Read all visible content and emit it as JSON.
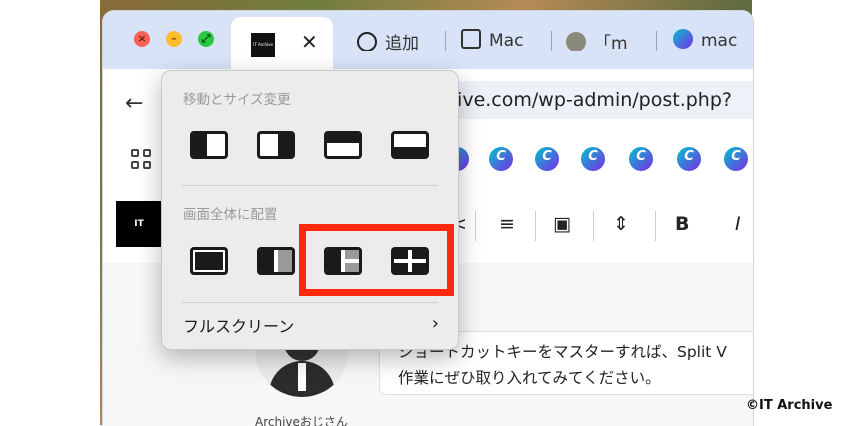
{
  "tabs": {
    "active": {
      "logo_text": "IT Archive",
      "close_label": "✕"
    },
    "others": [
      {
        "label": "追加",
        "icon": "chatgpt-icon"
      },
      {
        "label": "Mac",
        "icon": "pen-icon"
      },
      {
        "label": "「m",
        "icon": "animal-avatar-icon"
      },
      {
        "label": "mac",
        "icon": "canva-icon"
      }
    ]
  },
  "toolbar": {
    "back": "←",
    "url": "hive.com/wp-admin/post.php?"
  },
  "bookmarks": {
    "canva_letter": "C"
  },
  "editor": {
    "logo_text": "IT Archive",
    "bold": "B",
    "italic": "I"
  },
  "window_menu": {
    "move_resize_header": "移動とサイズ変更",
    "fill_arrange_header": "画面全体に配置",
    "fullscreen_label": "フルスクリーン",
    "chevron": "›"
  },
  "content": {
    "text_line1": "ショートカットキーをマスターすれば、Split V",
    "text_line2": "作業にぜひ取り入れてみてください。",
    "author_name": "Archiveおじさん"
  },
  "watermark": "©IT Archive",
  "colors": {
    "highlight": "#ff2a0d",
    "tabstrip": "#d9e3f7"
  }
}
